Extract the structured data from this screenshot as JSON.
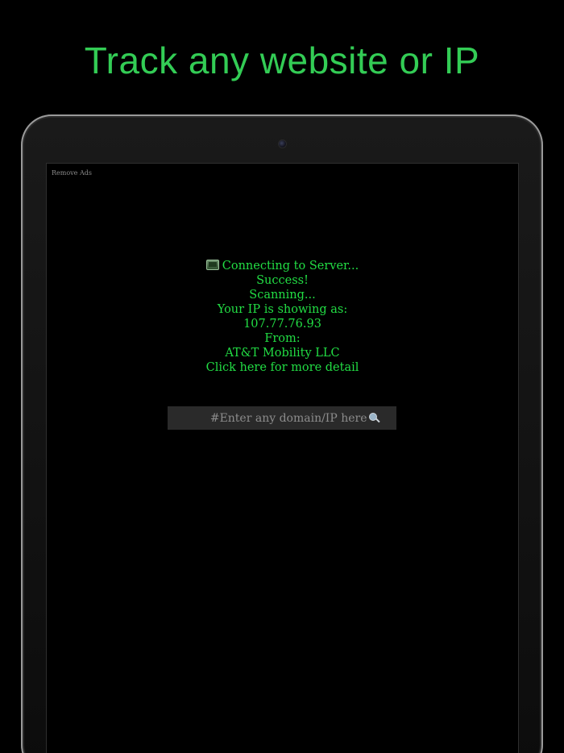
{
  "headline": "Track any website or IP",
  "screen": {
    "remove_ads_label": "Remove Ads",
    "console": {
      "connecting": "Connecting to Server...",
      "success": "Success!",
      "scanning": "Scanning...",
      "ip_label": "Your IP is showing as:",
      "ip_value": "107.77.76.93",
      "from_label": "From:",
      "isp": "AT&T Mobility LLC",
      "detail_link": "Click here for more detail"
    },
    "search": {
      "placeholder": "#Enter any domain/IP here",
      "value": ""
    }
  },
  "icons": {
    "console_icon": "computer-icon",
    "search_icon": "magnifier-icon"
  },
  "colors": {
    "headline": "#33cc55",
    "console_text": "#22dd44",
    "search_bg": "#2a2a2a",
    "placeholder": "#8c8c8c"
  }
}
